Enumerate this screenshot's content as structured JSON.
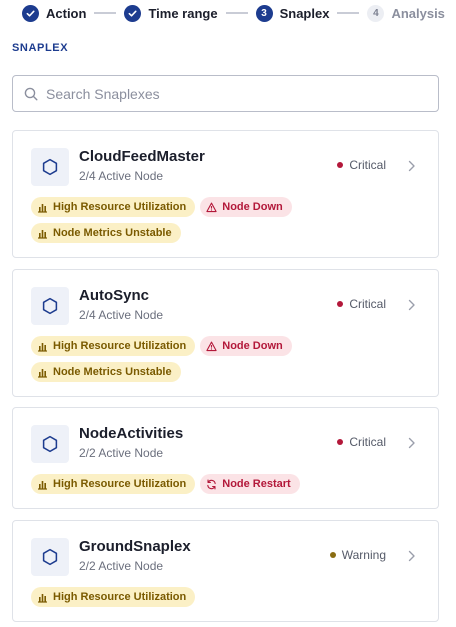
{
  "stepper": [
    {
      "label": "Action",
      "state": "done",
      "number": ""
    },
    {
      "label": "Time range",
      "state": "done",
      "number": ""
    },
    {
      "label": "Snaplex",
      "state": "active",
      "number": "3"
    },
    {
      "label": "Analysis",
      "state": "pending",
      "number": "4"
    }
  ],
  "section_title": "SNAPLEX",
  "search": {
    "placeholder": "Search Snaplexes",
    "icon": "search-icon"
  },
  "colors": {
    "primary": "#1d3c8f",
    "critical": "#b3183a",
    "warning": "#8a6d12",
    "badge_yellow_bg": "#fbf0c6",
    "badge_red_bg": "#fbe3e6"
  },
  "snaplexes": [
    {
      "name": "CloudFeedMaster",
      "nodes": "2/4 Active Node",
      "status": "Critical",
      "status_color": "#b3183a",
      "badges": [
        {
          "label": "High Resource Utilization",
          "icon": "bar-chart-icon",
          "tone": "yellow"
        },
        {
          "label": "Node Down",
          "icon": "warning-triangle-icon",
          "tone": "red"
        },
        {
          "label": "Node Metrics Unstable",
          "icon": "bar-chart-icon",
          "tone": "yellow"
        }
      ]
    },
    {
      "name": "AutoSync",
      "nodes": "2/4 Active Node",
      "status": "Critical",
      "status_color": "#b3183a",
      "badges": [
        {
          "label": "High Resource Utilization",
          "icon": "bar-chart-icon",
          "tone": "yellow"
        },
        {
          "label": "Node Down",
          "icon": "warning-triangle-icon",
          "tone": "red"
        },
        {
          "label": "Node Metrics Unstable",
          "icon": "bar-chart-icon",
          "tone": "yellow"
        }
      ]
    },
    {
      "name": "NodeActivities",
      "nodes": "2/2 Active Node",
      "status": "Critical",
      "status_color": "#b3183a",
      "badges": [
        {
          "label": "High Resource Utilization",
          "icon": "bar-chart-icon",
          "tone": "yellow"
        },
        {
          "label": "Node Restart",
          "icon": "refresh-icon",
          "tone": "red"
        }
      ]
    },
    {
      "name": "GroundSnaplex",
      "nodes": "2/2 Active Node",
      "status": "Warning",
      "status_color": "#8a6d12",
      "badges": [
        {
          "label": "High Resource Utilization",
          "icon": "bar-chart-icon",
          "tone": "yellow"
        }
      ]
    }
  ]
}
